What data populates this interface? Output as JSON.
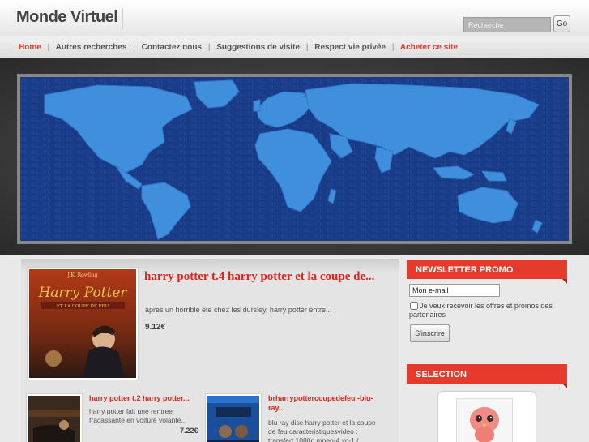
{
  "header": {
    "site_title": "Monde Virtuel",
    "search_placeholder": "Recherche",
    "go_label": "Go"
  },
  "nav": {
    "items": [
      {
        "label": "Home"
      },
      {
        "label": "Autres recherches"
      },
      {
        "label": "Contactez nous"
      },
      {
        "label": "Suggestions de visite"
      },
      {
        "label": "Respect vie privée"
      },
      {
        "label": "Acheter ce site"
      }
    ],
    "separator": "|"
  },
  "featured": {
    "title": "harry potter t.4 harry potter et la coupe de...",
    "description": "apres un horrible ete chez les dursley, harry potter entre...",
    "price": "9.12€",
    "cover_author": "J.K. Rowling",
    "cover_title": "Harry Potter",
    "cover_subtitle": "ET LA COUPE DE FEU"
  },
  "cards": [
    {
      "title": "harry potter t.2 harry potter...",
      "description": "harry potter fait une rentree fracassante en voiture volante...",
      "price": "7.22€"
    },
    {
      "title": "brharrypottercoupedefeu -blu-ray...",
      "description": "blu ray disc harry potter et la coupe de feu caracteristiquesvideo : transfert 1080p mpeg-4 vc-1 /"
    }
  ],
  "sidebar": {
    "newsletter": {
      "heading": "NEWSLETTER PROMO",
      "email_value": "Mon e-mail",
      "optin_label": "Je veux recevoir les offres et promos des partenaires",
      "subscribe_label": "S'inscrire"
    },
    "selection": {
      "heading": "SELECTION"
    }
  },
  "colors": {
    "accent": "#e3231c",
    "sidebar_head": "#e53a2c",
    "map_ocean": "#1a3b86",
    "map_land": "#3f8fdd"
  }
}
